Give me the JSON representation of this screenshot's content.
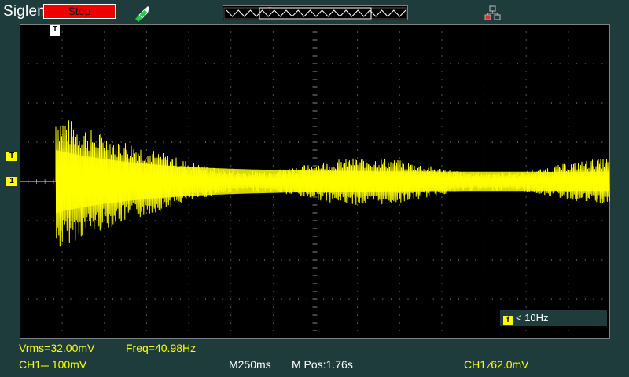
{
  "header": {
    "brand": "Siglent",
    "run_state": "Stop",
    "run_state_color": "#ee0000",
    "icons": [
      "probe-icon",
      "network-icon"
    ]
  },
  "display": {
    "trace_color": "#ffff00",
    "grid_color": "#808080",
    "background": "#000000",
    "channel_marker": "1",
    "trigger_level_marker": "T",
    "trigger_position_marker": "T"
  },
  "freq_badge": {
    "icon_label": "f",
    "text": "< 10Hz"
  },
  "measurements": {
    "vrms": "Vrms=32.00mV",
    "freq": "Freq=40.98Hz"
  },
  "status_bar": {
    "ch_scale": "CH1═ 100mV",
    "timebase": "M250ms",
    "mpos": "M Pos:1.76s",
    "trigger": "CH1 ∕62.0mV"
  }
}
